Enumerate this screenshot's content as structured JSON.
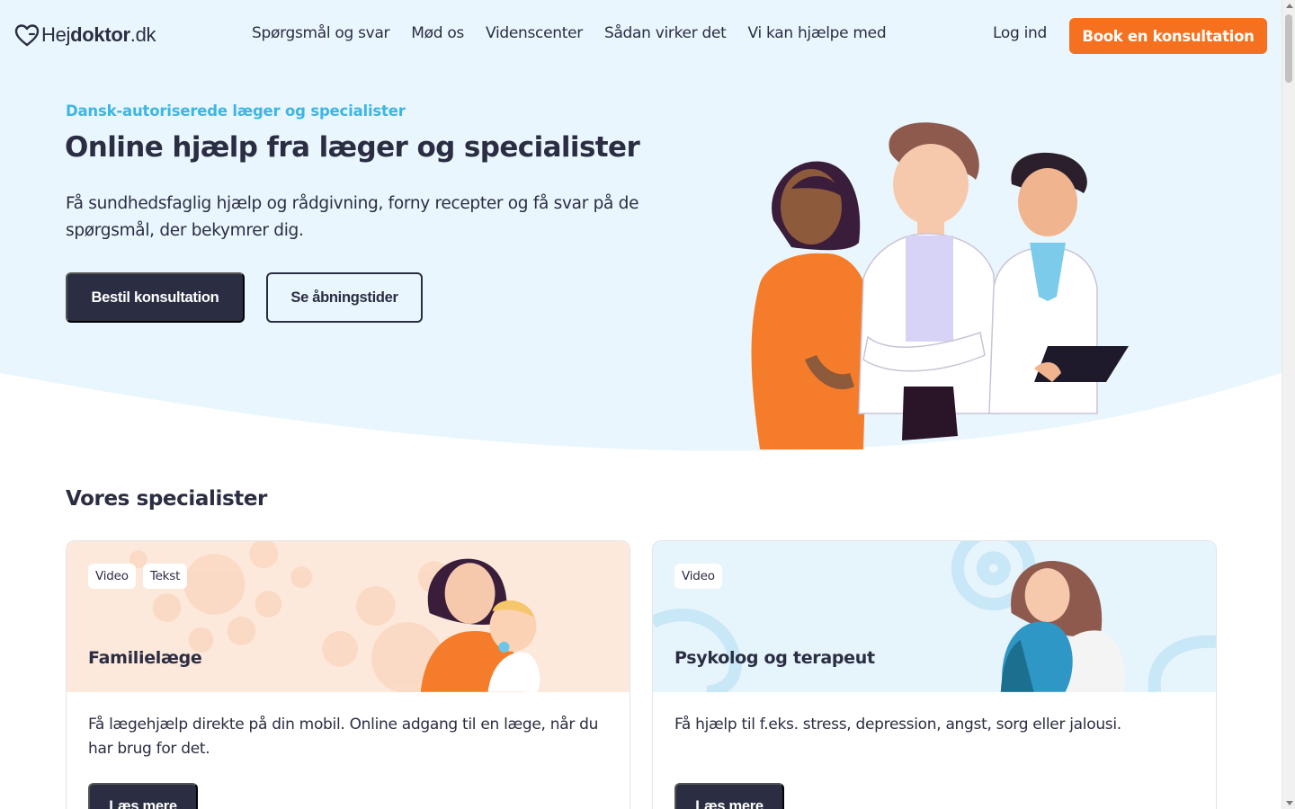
{
  "brand": {
    "logo_light": "Hej",
    "logo_bold": "doktor",
    "logo_suffix": ".dk",
    "accent": "#f5711f",
    "dark": "#2b2d42",
    "eyebrow_color": "#3eb5e5",
    "hero_bg": "#eaf6fd"
  },
  "nav": {
    "items": [
      {
        "label": "Spørgsmål og svar"
      },
      {
        "label": "Mød os"
      },
      {
        "label": "Videnscenter"
      },
      {
        "label": "Sådan virker det"
      },
      {
        "label": "Vi kan hjælpe med"
      }
    ],
    "login": "Log ind",
    "book": "Book en konsultation"
  },
  "hero": {
    "eyebrow": "Dansk-autoriserede læger og specialister",
    "title": "Online hjælp fra læger og specialister",
    "subtitle": "Få sundhedsfaglig hjælp og rådgivning, forny recepter og få svar på de spørgsmål, der bekymrer dig.",
    "primary_button": "Bestil konsultation",
    "secondary_button": "Se åbningstider"
  },
  "specialists": {
    "title": "Vores specialister",
    "cards": [
      {
        "tags": [
          "Video",
          "Tekst"
        ],
        "title": "Familielæge",
        "description": "Få lægehjælp direkte på din mobil. Online adgang til en læge, når du har brug for det.",
        "button": "Læs mere"
      },
      {
        "tags": [
          "Video"
        ],
        "title": "Psykolog og terapeut",
        "description": "Få hjælp til f.eks. stress, depression, angst, sorg eller jalousi.",
        "button": "Læs mere"
      }
    ]
  }
}
